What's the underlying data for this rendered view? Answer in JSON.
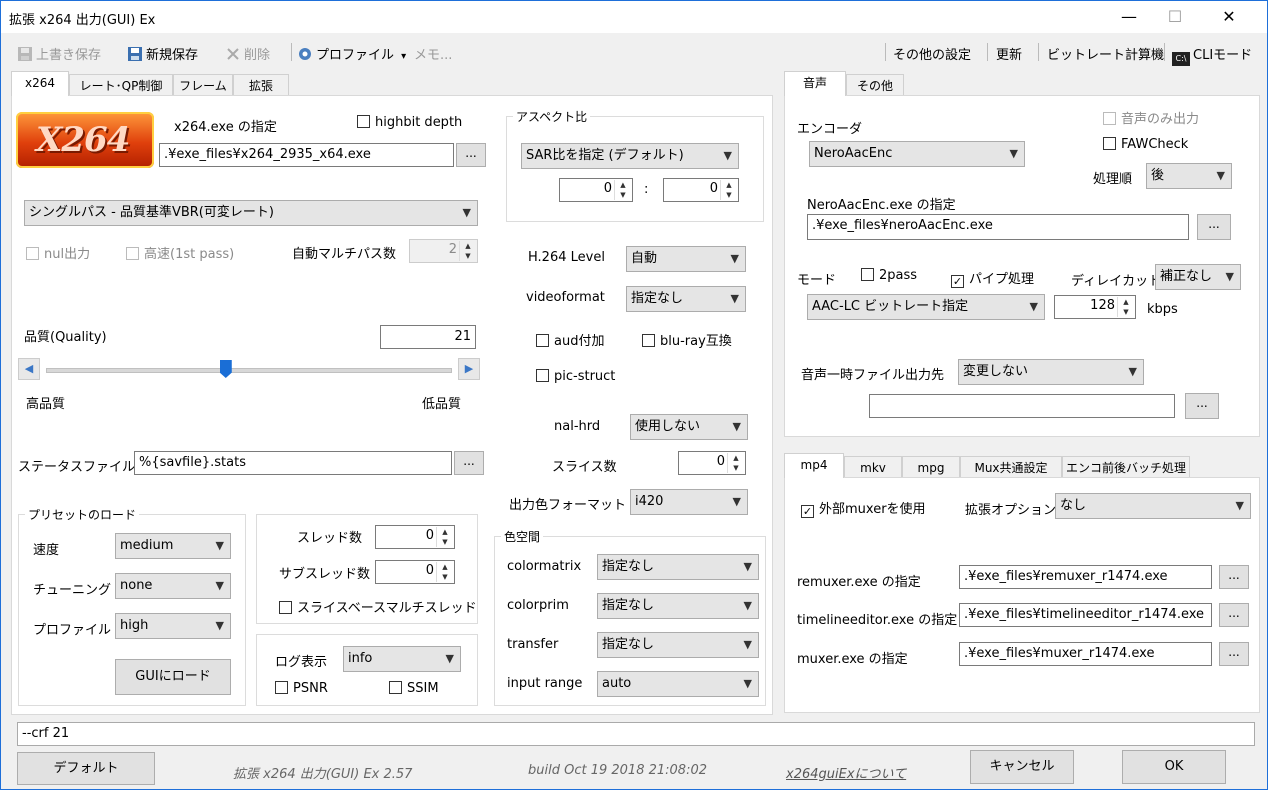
{
  "window": {
    "title": "拡張 x264 出力(GUI) Ex",
    "controls": {
      "minimize": "—",
      "maximize": "☐",
      "close": "✕"
    }
  },
  "toolbar": {
    "overwrite_save": "上書き保存",
    "new_save": "新規保存",
    "delete": "削除",
    "profile": "プロファイル",
    "profile_arrow": "▾",
    "memo": "メモ...",
    "other_settings": "その他の設定",
    "update": "更新",
    "bitrate_calc": "ビットレート計算機",
    "cli_mode": "CLIモード",
    "cli_icon_text": "C:\\"
  },
  "left_tabs": [
    "x264",
    "レート･QP制御",
    "フレーム",
    "拡張"
  ],
  "x264": {
    "logo_text": "X264",
    "exe_label": "x264.exe の指定",
    "highbit_depth": "highbit depth",
    "exe_path": ".¥exe_files¥x264_2935_x64.exe",
    "browse": "...",
    "mode": "シングルパス - 品質基準VBR(可変レート)",
    "nul_output": "nul出力",
    "fast_1st_pass": "高速(1st pass)",
    "auto_multipass_label": "自動マルチパス数",
    "auto_multipass_value": "2",
    "quality_label": "品質(Quality)",
    "quality_value": "21",
    "quality_fraction": 0.445,
    "high_quality": "高品質",
    "low_quality": "低品質",
    "status_file_label": "ステータスファイル",
    "status_file_value": "%{savfile}.stats",
    "preset": {
      "title": "プリセットのロード",
      "speed_label": "速度",
      "speed_value": "medium",
      "tuning_label": "チューニング",
      "tuning_value": "none",
      "profile_label": "プロファイル",
      "profile_value": "high",
      "load_button": "GUIにロード"
    },
    "threads": {
      "threads_label": "スレッド数",
      "threads_value": "0",
      "subthreads_label": "サブスレッド数",
      "subthreads_value": "0",
      "slice_based": "スライスベースマルチスレッド"
    },
    "log": {
      "label": "ログ表示",
      "value": "info",
      "psnr": "PSNR",
      "ssim": "SSIM"
    },
    "aspect": {
      "title": "アスペクト比",
      "mode": "SAR比を指定 (デフォルト)",
      "w": "0",
      "colon": ":",
      "h": "0"
    },
    "h264_level_label": "H.264 Level",
    "h264_level_value": "自動",
    "videoformat_label": "videoformat",
    "videoformat_value": "指定なし",
    "aud": "aud付加",
    "bluray": "blu-ray互換",
    "pic_struct": "pic-struct",
    "nal_hrd_label": "nal-hrd",
    "nal_hrd_value": "使用しない",
    "slices_label": "スライス数",
    "slices_value": "0",
    "output_csp_label": "出力色フォーマット",
    "output_csp_value": "i420",
    "colorspace": {
      "title": "色空間",
      "colormatrix_label": "colormatrix",
      "colormatrix_value": "指定なし",
      "colorprim_label": "colorprim",
      "colorprim_value": "指定なし",
      "transfer_label": "transfer",
      "transfer_value": "指定なし",
      "input_range_label": "input range",
      "input_range_value": "auto"
    }
  },
  "audio_tabs": [
    "音声",
    "その他"
  ],
  "audio": {
    "encoder_label": "エンコーダ",
    "encoder_value": "NeroAacEnc",
    "audio_only": "音声のみ出力",
    "faw_check": "FAWCheck",
    "order_label": "処理順",
    "order_value": "後",
    "exe_label": "NeroAacEnc.exe の指定",
    "exe_path": ".¥exe_files¥neroAacEnc.exe",
    "mode_label": "モード",
    "two_pass": "2pass",
    "pipe": "パイプ処理",
    "delay_label": "ディレイカット",
    "delay_value": "補正なし",
    "mode_value": "AAC-LC ビットレート指定",
    "bitrate": "128",
    "kbps": "kbps",
    "temp_label": "音声一時ファイル出力先",
    "temp_value": "変更しない",
    "temp_path": ""
  },
  "mux_tabs": [
    "mp4",
    "mkv",
    "mpg",
    "Mux共通設定",
    "エンコ前後バッチ処理"
  ],
  "mux": {
    "use_external": "外部muxerを使用",
    "ext_option_label": "拡張オプション",
    "ext_option_value": "なし",
    "remuxer_label": "remuxer.exe の指定",
    "remuxer_path": ".¥exe_files¥remuxer_r1474.exe",
    "timeline_label": "timelineeditor.exe の指定",
    "timeline_path": ".¥exe_files¥timelineeditor_r1474.exe",
    "muxer_label": "muxer.exe の指定",
    "muxer_path": ".¥exe_files¥muxer_r1474.exe"
  },
  "cmdline": "--crf 21",
  "footer": {
    "default": "デフォルト",
    "version": "拡張 x264 出力(GUI) Ex 2.57",
    "build": "build Oct 19 2018 21:08:02",
    "about": "x264guiExについて",
    "cancel": "キャンセル",
    "ok": "OK"
  }
}
